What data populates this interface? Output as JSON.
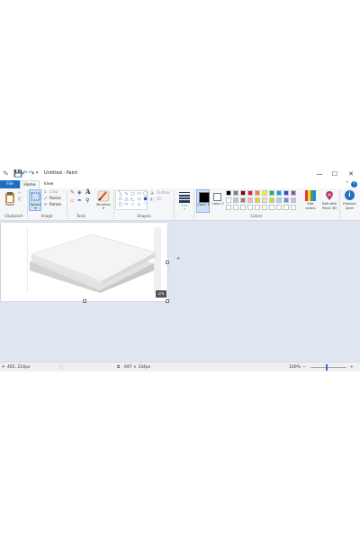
{
  "app": {
    "title": "Untitled - Paint"
  },
  "window_controls": {
    "minimize": "—",
    "maximize": "☐",
    "close": "✕"
  },
  "menu": {
    "file": "File",
    "home": "Home",
    "view": "View",
    "help": "?",
    "collapse": "^"
  },
  "ribbon": {
    "clipboard": {
      "paste": "Paste",
      "group": "Clipboard"
    },
    "image": {
      "select": "Select",
      "crop": "Crop",
      "resize": "Resize",
      "rotate": "Rotate",
      "group": "Image"
    },
    "tools": {
      "group": "Tools",
      "text_tool": "A"
    },
    "brushes": {
      "label": "Brushes"
    },
    "shapes": {
      "outline": "Outline",
      "fill": "Fill",
      "group": "Shapes"
    },
    "size": {
      "label": "Size"
    },
    "colors": {
      "color1": "Color 1",
      "color2": "Color 2",
      "edit_colors": "Edit colors",
      "edit_paint3d": "Edit with Paint 3D",
      "product_alert": "Product alert",
      "group": "Colors",
      "color1_value": "#000000",
      "color2_value": "#ffffff",
      "palette_row1": [
        "#000000",
        "#7f7f7f",
        "#880015",
        "#ed1c24",
        "#ff7f27",
        "#fff200",
        "#22b14c",
        "#00a2e8",
        "#3f48cc",
        "#a349a4"
      ],
      "palette_row2": [
        "#ffffff",
        "#c3c3c3",
        "#b97a57",
        "#ffaec9",
        "#ffc90e",
        "#efe4b0",
        "#b5e61d",
        "#99d9ea",
        "#7092be",
        "#c8bfe7"
      ],
      "palette_row3": [
        "#ffffff",
        "#ffffff",
        "#ffffff",
        "#ffffff",
        "#ffffff",
        "#ffffff",
        "#ffffff",
        "#ffffff",
        "#ffffff",
        "#ffffff"
      ]
    }
  },
  "canvas": {
    "badge": "ATB"
  },
  "status": {
    "cursor_pos": "465, 214px",
    "image_size": "697 × 334px",
    "zoom": "100%",
    "zoom_minus": "−",
    "zoom_plus": "+"
  }
}
